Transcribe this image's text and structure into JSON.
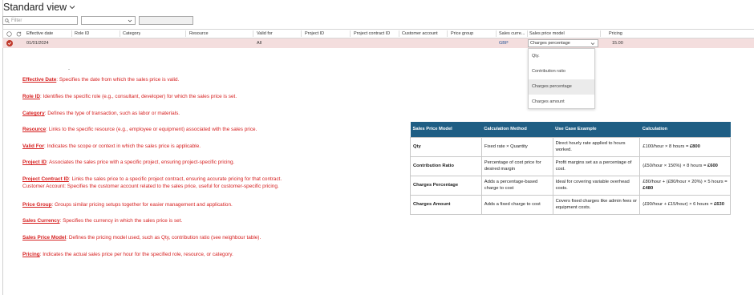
{
  "header": {
    "title": "Standard view"
  },
  "filters": {
    "search_placeholder": "Filter"
  },
  "grid": {
    "columns": [
      "Effective date",
      "Role ID",
      "Category",
      "Resource",
      "Valid for",
      "Project ID",
      "Project contract ID",
      "Customer account",
      "Price group",
      "Sales curre...",
      "Sales price model",
      "Pricing"
    ],
    "row": {
      "effective_date": "01/01/2024",
      "valid_for": "All",
      "sales_currency": "GBP",
      "sales_price_model": "Charges percentage",
      "pricing": "15.00"
    }
  },
  "dropdown": {
    "options": [
      "Qty.",
      "Contribution ratio",
      "Charges percentage",
      "Charges amount"
    ],
    "selected": "Charges percentage"
  },
  "stray_mark": "-",
  "definitions": [
    {
      "term": "Effective Date",
      "text": ": Specifies the date from which the sales price is valid."
    },
    {
      "term": "Role ID",
      "text": ": Identifies the specific role (e.g., consultant, developer) for which the sales price is set."
    },
    {
      "term": "Category",
      "text": ": Defines the type of transaction, such as labor or materials."
    },
    {
      "term": "Resource",
      "text": ": Links to the specific resource (e.g., employee or equipment) associated with the sales price."
    },
    {
      "term": "Valid For",
      "text": ": Indicates the scope or context in which the sales price is applicable."
    },
    {
      "term": "Project ID",
      "text": ": Associates the sales price with a specific project, ensuring project-specific pricing."
    },
    {
      "term": "Project Contract ID",
      "text": ": Links the sales price to a specific project contract, ensuring accurate pricing for that contract.",
      "extra": "Customer Account: Specifies the customer account related to the sales price, useful for customer-specific pricing."
    },
    {
      "term": "Price Group",
      "text": ": Groups similar pricing setups together for easier management and application."
    },
    {
      "term": "Sales Currency",
      "text": ": Specifies the currency in which the sales price is set."
    },
    {
      "term": "Sales Price Model",
      "text": ": Defines the pricing model used, such as Qty, contribution ratio (see neighbour table)."
    },
    {
      "term": "Pricing",
      "text": ": Indicates the actual sales price per hour for the specified role, resource, or category."
    }
  ],
  "reference_table": {
    "headers": [
      "Sales Price Model",
      "Calculation Method",
      "Use Case Example",
      "Calculation"
    ],
    "rows": [
      {
        "model": "Qty",
        "method": "Fixed rate × Quantity",
        "example": "Direct hourly rate applied to hours worked.",
        "calc_pre": "£100/hour × 8 hours = ",
        "calc_bold": "£800"
      },
      {
        "model": "Contribution Ratio",
        "method": "Percentage of cost price for desired margin",
        "example": "Profit margins set as a percentage of cost.",
        "calc_pre": "(£50/hour × 150%) × 8 hours = ",
        "calc_bold": "£600"
      },
      {
        "model": "Charges Percentage",
        "method": "Adds a percentage-based charge to cost",
        "example": "Ideal for covering variable overhead costs.",
        "calc_pre": "£80/hour + (£80/hour × 20%) × 5 hours = ",
        "calc_bold": "£480"
      },
      {
        "model": "Charges Amount",
        "method": "Adds a fixed charge to cost",
        "example": "Covers fixed charges like admin fees or equipment costs.",
        "calc_pre": "(£90/hour + £15/hour) × 6 hours = ",
        "calc_bold": "£630"
      }
    ]
  },
  "colors": {
    "accent_red": "#d61f1f",
    "table_header": "#1f5e84",
    "row_highlight": "#f4dede"
  }
}
